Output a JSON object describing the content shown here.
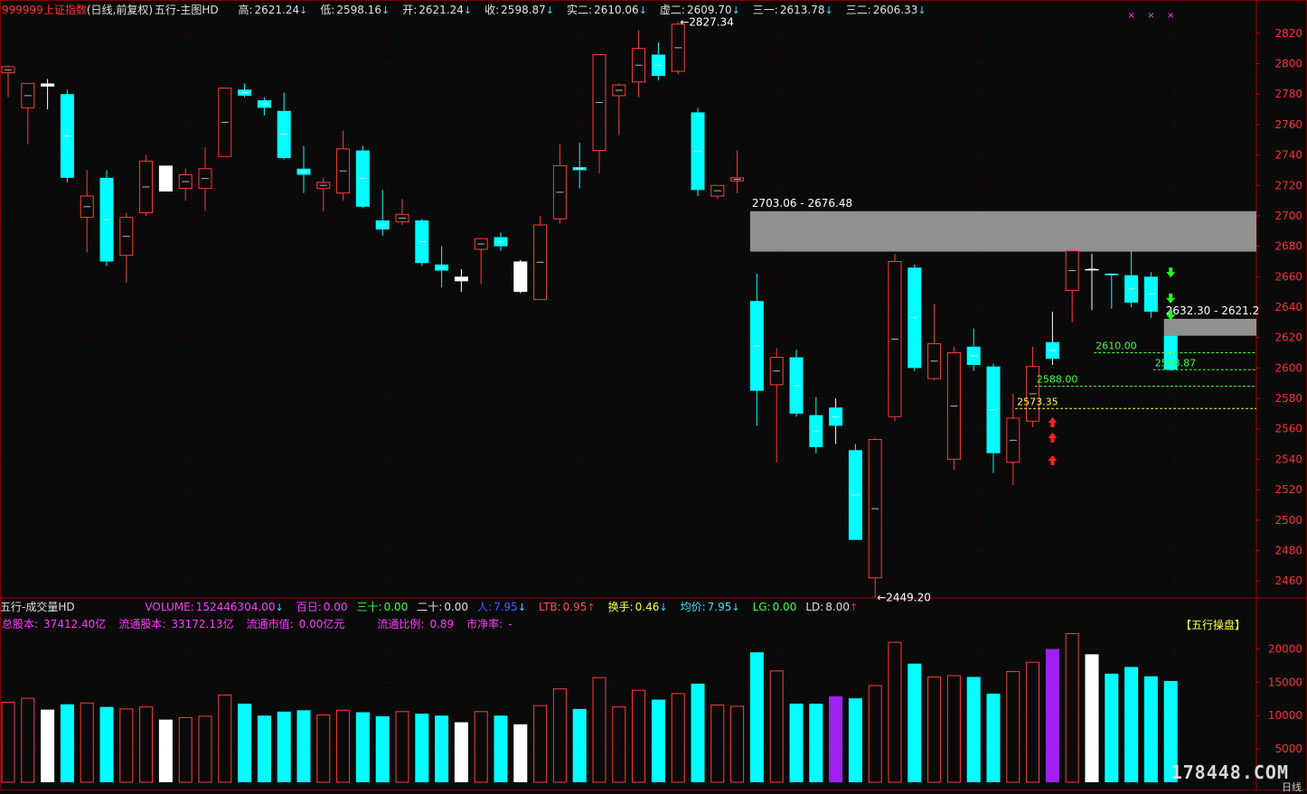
{
  "header": {
    "code": "999999",
    "name": "上证指数",
    "period": "(日线,前复权)",
    "template": "五行-主图HD",
    "items": [
      {
        "label": "高:",
        "value": "2621.24",
        "arrow": "down"
      },
      {
        "label": "低:",
        "value": "2598.16",
        "arrow": "down"
      },
      {
        "label": "开:",
        "value": "2621.24",
        "arrow": "down"
      },
      {
        "label": "收:",
        "value": "2598.87",
        "arrow": "down"
      },
      {
        "label": "实二:",
        "value": "2610.06",
        "arrow": "down"
      },
      {
        "label": "虚二:",
        "value": "2609.70",
        "arrow": "down"
      },
      {
        "label": "三一:",
        "value": "2613.78",
        "arrow": "down"
      },
      {
        "label": "三二:",
        "value": "2606.33",
        "arrow": "down"
      }
    ]
  },
  "volume_header": {
    "title": "五行-成交量HD",
    "items": [
      {
        "label": "VOLUME:",
        "value": "152446304.00",
        "arrow": "down",
        "color": "#ff3cff"
      },
      {
        "label": "百日:",
        "value": "0.00",
        "arrow": "",
        "color": "#ff3cff"
      },
      {
        "label": "三十:",
        "value": "0.00",
        "arrow": "",
        "color": "#40ff40"
      },
      {
        "label": "二十:",
        "value": "0.00",
        "arrow": "",
        "color": "#e0e0e0"
      },
      {
        "label": "人:",
        "value": "7.95",
        "arrow": "down",
        "color": "#4060ff"
      },
      {
        "label": "LTB:",
        "value": "0.95",
        "arrow": "up",
        "color": "#ff5050"
      },
      {
        "label": "换手:",
        "value": "0.46",
        "arrow": "down",
        "color": "#ffff40"
      },
      {
        "label": "均价:",
        "value": "7.95",
        "arrow": "down",
        "color": "#40e0ff"
      },
      {
        "label": "LG:",
        "value": "0.00",
        "arrow": "",
        "color": "#40ff40"
      },
      {
        "label": "LD:",
        "value": "8.00",
        "arrow": "up",
        "color": "#e0e0e0"
      }
    ],
    "info": [
      {
        "label": "总股本:",
        "value": "37412.40亿"
      },
      {
        "label": "流通股本:",
        "value": "33172.13亿"
      },
      {
        "label": "流通市值:",
        "value": "0.00亿元"
      },
      {
        "label": "流通比例:",
        "value": "0.89"
      },
      {
        "label": "市净率:",
        "value": "-"
      }
    ],
    "brand": "【五行操盘】"
  },
  "watermark": "178448.COM",
  "corner_label": "日线",
  "chart_data": {
    "type": "candlestick",
    "price_axis": {
      "min": 2450,
      "max": 2830,
      "ticks": [
        2460,
        2480,
        2500,
        2520,
        2540,
        2560,
        2580,
        2600,
        2620,
        2640,
        2660,
        2680,
        2700,
        2720,
        2740,
        2760,
        2780,
        2800,
        2820
      ]
    },
    "volume_axis": {
      "min": 0,
      "max": 22500,
      "ticks": [
        5000,
        10000,
        15000,
        20000
      ]
    },
    "candles": [
      {
        "o": 2794,
        "h": 2799,
        "l": 2778,
        "c": 2798,
        "v": 12000,
        "col": "red"
      },
      {
        "o": 2771,
        "h": 2787,
        "l": 2747,
        "c": 2787,
        "v": 12600,
        "col": "red"
      },
      {
        "o": 2787,
        "h": 2790,
        "l": 2770,
        "c": 2785,
        "v": 10900,
        "col": "white"
      },
      {
        "o": 2780,
        "h": 2783,
        "l": 2722,
        "c": 2725,
        "v": 11700,
        "col": "cyan"
      },
      {
        "o": 2699,
        "h": 2730,
        "l": 2676,
        "c": 2713,
        "v": 11900,
        "col": "red"
      },
      {
        "o": 2725,
        "h": 2730,
        "l": 2667,
        "c": 2670,
        "v": 11300,
        "col": "cyan"
      },
      {
        "o": 2674,
        "h": 2702,
        "l": 2656,
        "c": 2699,
        "v": 11000,
        "col": "red"
      },
      {
        "o": 2702,
        "h": 2740,
        "l": 2700,
        "c": 2736,
        "v": 11300,
        "col": "red"
      },
      {
        "o": 2733,
        "h": 2733,
        "l": 2716,
        "c": 2716,
        "v": 9400,
        "col": "white"
      },
      {
        "o": 2718,
        "h": 2731,
        "l": 2710,
        "c": 2727,
        "v": 9700,
        "col": "red"
      },
      {
        "o": 2718,
        "h": 2745,
        "l": 2703,
        "c": 2731,
        "v": 9900,
        "col": "red"
      },
      {
        "o": 2739,
        "h": 2784,
        "l": 2739,
        "c": 2784,
        "v": 13100,
        "col": "red"
      },
      {
        "o": 2783,
        "h": 2787,
        "l": 2778,
        "c": 2779,
        "v": 11800,
        "col": "cyan"
      },
      {
        "o": 2776,
        "h": 2778,
        "l": 2766,
        "c": 2771,
        "v": 10000,
        "col": "cyan"
      },
      {
        "o": 2769,
        "h": 2781,
        "l": 2737,
        "c": 2738,
        "v": 10600,
        "col": "cyan"
      },
      {
        "o": 2731,
        "h": 2746,
        "l": 2715,
        "c": 2727,
        "v": 10800,
        "col": "cyan"
      },
      {
        "o": 2718,
        "h": 2725,
        "l": 2703,
        "c": 2722,
        "v": 10100,
        "col": "red"
      },
      {
        "o": 2715,
        "h": 2756,
        "l": 2710,
        "c": 2744,
        "v": 10800,
        "col": "red"
      },
      {
        "o": 2743,
        "h": 2746,
        "l": 2705,
        "c": 2706,
        "v": 10500,
        "col": "cyan"
      },
      {
        "o": 2697,
        "h": 2717,
        "l": 2687,
        "c": 2691,
        "v": 9900,
        "col": "cyan"
      },
      {
        "o": 2696,
        "h": 2711,
        "l": 2694,
        "c": 2701,
        "v": 10600,
        "col": "red"
      },
      {
        "o": 2697,
        "h": 2698,
        "l": 2667,
        "c": 2669,
        "v": 10300,
        "col": "cyan"
      },
      {
        "o": 2668,
        "h": 2680,
        "l": 2653,
        "c": 2664,
        "v": 10000,
        "col": "cyan"
      },
      {
        "o": 2660,
        "h": 2665,
        "l": 2650,
        "c": 2657,
        "v": 9000,
        "col": "white"
      },
      {
        "o": 2678,
        "h": 2684,
        "l": 2655,
        "c": 2685,
        "v": 10600,
        "col": "red"
      },
      {
        "o": 2686,
        "h": 2689,
        "l": 2677,
        "c": 2680,
        "v": 10000,
        "col": "cyan"
      },
      {
        "o": 2670,
        "h": 2671,
        "l": 2649,
        "c": 2650,
        "v": 8700,
        "col": "white"
      },
      {
        "o": 2645,
        "h": 2700,
        "l": 2645,
        "c": 2694,
        "v": 11500,
        "col": "red"
      },
      {
        "o": 2698,
        "h": 2747,
        "l": 2695,
        "c": 2733,
        "v": 14000,
        "col": "red"
      },
      {
        "o": 2732,
        "h": 2748,
        "l": 2718,
        "c": 2730,
        "v": 11000,
        "col": "cyan"
      },
      {
        "o": 2743,
        "h": 2806,
        "l": 2728,
        "c": 2806,
        "v": 15700,
        "col": "red"
      },
      {
        "o": 2779,
        "h": 2787,
        "l": 2753,
        "c": 2786,
        "v": 11300,
        "col": "red"
      },
      {
        "o": 2788,
        "h": 2822,
        "l": 2778,
        "c": 2810,
        "v": 13800,
        "col": "red"
      },
      {
        "o": 2806,
        "h": 2814,
        "l": 2789,
        "c": 2792,
        "v": 12400,
        "col": "cyan"
      },
      {
        "o": 2795,
        "h": 2827.34,
        "l": 2793,
        "c": 2826,
        "v": 13300,
        "col": "red"
      },
      {
        "o": 2768,
        "h": 2771,
        "l": 2713,
        "c": 2717,
        "v": 14800,
        "col": "cyan"
      },
      {
        "o": 2713,
        "h": 2720,
        "l": 2711,
        "c": 2720,
        "v": 11600,
        "col": "red"
      },
      {
        "o": 2723,
        "h": 2743,
        "l": 2715,
        "c": 2725,
        "v": 11400,
        "col": "red"
      },
      {
        "o": 2644,
        "h": 2662,
        "l": 2562,
        "c": 2585,
        "v": 19500,
        "col": "cyan"
      },
      {
        "o": 2589,
        "h": 2613,
        "l": 2538,
        "c": 2607,
        "v": 16700,
        "col": "red"
      },
      {
        "o": 2607,
        "h": 2612,
        "l": 2568,
        "c": 2570,
        "v": 11800,
        "col": "cyan"
      },
      {
        "o": 2569,
        "h": 2581,
        "l": 2544,
        "c": 2548,
        "v": 11800,
        "col": "cyan"
      },
      {
        "o": 2574,
        "h": 2580,
        "l": 2550,
        "c": 2562,
        "v": 12900,
        "col": "magenta"
      },
      {
        "o": 2546,
        "h": 2550,
        "l": 2517,
        "c": 2487,
        "v": 12600,
        "col": "cyan"
      },
      {
        "o": 2462,
        "h": 2554,
        "l": 2449.2,
        "c": 2553,
        "v": 14500,
        "col": "red"
      },
      {
        "o": 2568,
        "h": 2675,
        "l": 2565,
        "c": 2670,
        "v": 21000,
        "col": "red"
      },
      {
        "o": 2666,
        "h": 2668,
        "l": 2598,
        "c": 2600,
        "v": 17800,
        "col": "cyan"
      },
      {
        "o": 2593,
        "h": 2642,
        "l": 2592,
        "c": 2616,
        "v": 15800,
        "col": "red"
      },
      {
        "o": 2540,
        "h": 2614,
        "l": 2533,
        "c": 2610,
        "v": 16000,
        "col": "red"
      },
      {
        "o": 2614,
        "h": 2626,
        "l": 2598,
        "c": 2602,
        "v": 15800,
        "col": "cyan"
      },
      {
        "o": 2601,
        "h": 2603,
        "l": 2531,
        "c": 2544,
        "v": 13300,
        "col": "cyan"
      },
      {
        "o": 2538,
        "h": 2583,
        "l": 2523,
        "c": 2567,
        "v": 16600,
        "col": "red"
      },
      {
        "o": 2565,
        "h": 2614,
        "l": 2561,
        "c": 2601,
        "v": 18000,
        "col": "red"
      },
      {
        "o": 2617,
        "h": 2637,
        "l": 2602,
        "c": 2606,
        "v": 20000,
        "col": "magenta"
      },
      {
        "o": 2651,
        "h": 2677,
        "l": 2630,
        "c": 2677,
        "v": 22300,
        "col": "red"
      },
      {
        "o": 2665,
        "h": 2675,
        "l": 2638,
        "c": 2665,
        "v": 19200,
        "col": "white"
      },
      {
        "o": 2662,
        "h": 2662,
        "l": 2639,
        "c": 2661,
        "v": 16300,
        "col": "cyan"
      },
      {
        "o": 2661,
        "h": 2677,
        "l": 2640,
        "c": 2643,
        "v": 17300,
        "col": "cyan"
      },
      {
        "o": 2660,
        "h": 2663,
        "l": 2633,
        "c": 2637,
        "v": 15900,
        "col": "cyan"
      },
      {
        "o": 2621.24,
        "h": 2621.24,
        "l": 2598.16,
        "c": 2598.87,
        "v": 15200,
        "col": "cyan"
      }
    ],
    "zones": [
      {
        "label": "2703.06 - 2676.48",
        "from": 2676.48,
        "to": 2703.06,
        "start_index": 38
      },
      {
        "label": "2632.30 - 2621.2",
        "from": 2621.2,
        "to": 2632.3,
        "start_index": 59
      }
    ],
    "levels": [
      {
        "label": "2610.00",
        "value": 2610.0,
        "color": "#40ff40",
        "start_index": 56
      },
      {
        "label": "2598.87",
        "value": 2598.87,
        "color": "#40ff40",
        "start_index": 59
      },
      {
        "label": "2588.00",
        "value": 2588.0,
        "color": "#40ff40",
        "start_index": 53
      },
      {
        "label": "2573.35",
        "value": 2573.35,
        "color": "#ffff40",
        "start_index": 52
      }
    ],
    "extremes": [
      {
        "label": "2827.34",
        "index": 34,
        "value": 2827.34,
        "kind": "high"
      },
      {
        "label": "2449.20",
        "index": 44,
        "value": 2449.2,
        "kind": "low"
      }
    ],
    "signals": {
      "up_arrows": {
        "index": 53,
        "values": [
          2564,
          2554,
          2539
        ]
      },
      "down_arrows": {
        "index": 59,
        "values": [
          2663,
          2646,
          2635
        ]
      },
      "crosses": {
        "indices": [
          57,
          58,
          59
        ]
      }
    }
  }
}
